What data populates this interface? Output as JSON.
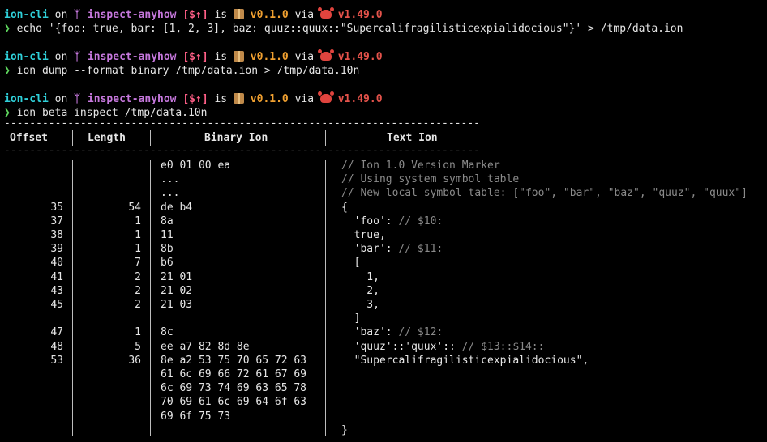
{
  "prompts": [
    {
      "project": "ion-cli",
      "on": "on",
      "branch_glyph": "ᛉ",
      "branch": "inspect-anyhow",
      "status": "[$↑]",
      "is": "is",
      "version": "v0.1.0",
      "via": "via",
      "rust": "v1.49.0",
      "caret": "❯",
      "command": "echo '{foo: true, bar: [1, 2, 3], baz: quuz::quux::\"Supercalifragilisticexpialidocious\"}' > /tmp/data.ion"
    },
    {
      "project": "ion-cli",
      "on": "on",
      "branch_glyph": "ᛉ",
      "branch": "inspect-anyhow",
      "status": "[$↑]",
      "is": "is",
      "version": "v0.1.0",
      "via": "via",
      "rust": "v1.49.0",
      "caret": "❯",
      "command": "ion dump --format binary /tmp/data.ion > /tmp/data.10n"
    },
    {
      "project": "ion-cli",
      "on": "on",
      "branch_glyph": "ᛉ",
      "branch": "inspect-anyhow",
      "status": "[$↑]",
      "is": "is",
      "version": "v0.1.0",
      "via": "via",
      "rust": "v1.49.0",
      "caret": "❯",
      "command": "ion beta inspect /tmp/data.10n"
    }
  ],
  "table": {
    "rule": "---------------------------------------------------------------------------",
    "headers": {
      "offset": "Offset",
      "length": "Length",
      "binary": "Binary Ion",
      "text": "Text Ion"
    },
    "rows": [
      {
        "offset": "",
        "length": "",
        "binary": "e0 01 00 ea",
        "text": "// Ion 1.0 Version Marker",
        "text_kind": "comment"
      },
      {
        "offset": "",
        "length": "",
        "binary": "...",
        "text": "// Using system symbol table",
        "text_kind": "comment"
      },
      {
        "offset": "",
        "length": "",
        "binary": "...",
        "text": "// New local symbol table: [\"foo\", \"bar\", \"baz\", \"quuz\", \"quux\"]",
        "text_kind": "comment"
      },
      {
        "offset": "35",
        "length": "54",
        "binary": "de b4",
        "text": "{",
        "text_kind": "plain"
      },
      {
        "offset": "37",
        "length": "1",
        "binary": "8a",
        "text": "  'foo': ",
        "comment": "// $10:"
      },
      {
        "offset": "38",
        "length": "1",
        "binary": "11",
        "text": "  true,",
        "text_kind": "plain"
      },
      {
        "offset": "39",
        "length": "1",
        "binary": "8b",
        "text": "  'bar': ",
        "comment": "// $11:"
      },
      {
        "offset": "40",
        "length": "7",
        "binary": "b6",
        "text": "  [",
        "text_kind": "plain"
      },
      {
        "offset": "41",
        "length": "2",
        "binary": "21 01",
        "text": "    1,",
        "text_kind": "plain"
      },
      {
        "offset": "43",
        "length": "2",
        "binary": "21 02",
        "text": "    2,",
        "text_kind": "plain"
      },
      {
        "offset": "45",
        "length": "2",
        "binary": "21 03",
        "text": "    3,",
        "text_kind": "plain"
      },
      {
        "offset": "",
        "length": "",
        "binary": "",
        "text": "  ]",
        "text_kind": "plain"
      },
      {
        "offset": "47",
        "length": "1",
        "binary": "8c",
        "text": "  'baz': ",
        "comment": "// $12:"
      },
      {
        "offset": "48",
        "length": "5",
        "binary": "ee a7 82 8d 8e",
        "text": "  'quuz'::'quux':: ",
        "comment": "// $13::$14::"
      },
      {
        "offset": "53",
        "length": "36",
        "binary": "8e a2 53 75 70 65 72 63",
        "text": "  \"Supercalifragilisticexpialidocious\",",
        "text_kind": "plain"
      },
      {
        "offset": "",
        "length": "",
        "binary": "61 6c 69 66 72 61 67 69",
        "text": "",
        "text_kind": "plain"
      },
      {
        "offset": "",
        "length": "",
        "binary": "6c 69 73 74 69 63 65 78",
        "text": "",
        "text_kind": "plain"
      },
      {
        "offset": "",
        "length": "",
        "binary": "70 69 61 6c 69 64 6f 63",
        "text": "",
        "text_kind": "plain"
      },
      {
        "offset": "",
        "length": "",
        "binary": "69 6f 75 73",
        "text": "",
        "text_kind": "plain"
      },
      {
        "offset": "",
        "length": "",
        "binary": "",
        "text": "}",
        "text_kind": "plain"
      }
    ]
  },
  "colors": {
    "background": "#000000",
    "project": "#2fd0d9",
    "branch": "#c678dd",
    "status": "#ff5f87",
    "version": "#f0a030",
    "rust": "#e5534b",
    "prompt_caret": "#5fd75f",
    "comment": "#8a8a8a"
  },
  "icons": {
    "package": "package-icon",
    "rust": "crab-icon",
    "branch": "git-branch-icon"
  }
}
